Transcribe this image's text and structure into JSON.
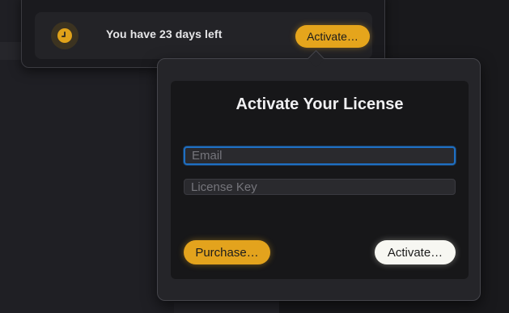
{
  "trial": {
    "message": "You have 23 days left",
    "activate_label": "Activate…",
    "icon": "clock-icon"
  },
  "activation": {
    "title": "Activate Your License",
    "email_placeholder": "Email",
    "license_placeholder": "License Key",
    "email_value": "",
    "license_value": "",
    "purchase_label": "Purchase…",
    "activate_label": "Activate…"
  },
  "colors": {
    "accent": "#e5a51c",
    "focus_ring": "#1f6fc2",
    "background": "#171719"
  }
}
